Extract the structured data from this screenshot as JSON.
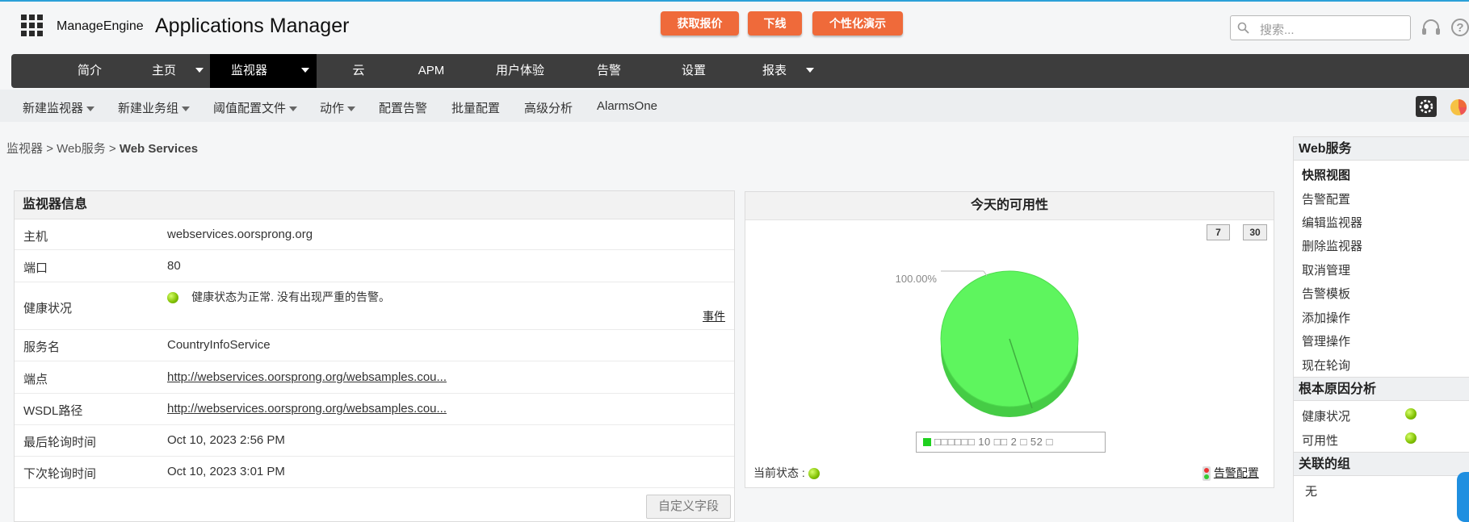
{
  "header": {
    "logo_brand": "ManageEngine",
    "logo_product": "Applications Manager",
    "buttons": {
      "quote": "获取报价",
      "download": "下线",
      "demo": "个性化演示"
    },
    "search_placeholder": "搜索...",
    "help_label": "?"
  },
  "nav": {
    "items": [
      {
        "label": "简介"
      },
      {
        "label": "主页"
      },
      {
        "label": "监视器"
      },
      {
        "label": "云"
      },
      {
        "label": "APM"
      },
      {
        "label": "用户体验"
      },
      {
        "label": "告警"
      },
      {
        "label": "设置"
      },
      {
        "label": "报表"
      }
    ],
    "active": "监视器"
  },
  "subnav": {
    "items": [
      {
        "label": "新建监视器"
      },
      {
        "label": "新建业务组"
      },
      {
        "label": "阈值配置文件"
      },
      {
        "label": "动作"
      },
      {
        "label": "配置告警"
      },
      {
        "label": "批量配置"
      },
      {
        "label": "高级分析"
      },
      {
        "label": "AlarmsOne"
      }
    ]
  },
  "breadcrumb": {
    "part1": "监视器",
    "sep": ">",
    "part2": "Web服务",
    "current": "Web Services"
  },
  "monitor_info": {
    "title": "监视器信息",
    "rows": [
      {
        "label": "主机",
        "value": "webservices.oorsprong.org"
      },
      {
        "label": "端口",
        "value": "80"
      },
      {
        "label": "健康状况",
        "value": "健康状态为正常. 没有出现严重的告警。",
        "link": "事件"
      },
      {
        "label": "服务名",
        "value": "CountryInfoService"
      },
      {
        "label": "端点",
        "value": "http://webservices.oorsprong.org/websamples.cou..."
      },
      {
        "label": "WSDL路径",
        "value": "http://webservices.oorsprong.org/websamples.cou..."
      },
      {
        "label": "最后轮询时间",
        "value": "Oct 10, 2023 2:56 PM"
      },
      {
        "label": "下次轮询时间",
        "value": "Oct 10, 2023 3:01 PM"
      }
    ],
    "custom_fields_button": "自定义字段"
  },
  "availability": {
    "title": "今天的可用性",
    "btn7": "7",
    "btn30": "30",
    "pie_label": "100.00%",
    "legend_text": "□□□□□□ 10 □□ 2 □ 52 □",
    "current_status_label": "当前状态 :",
    "alert_config_link": "告警配置",
    "colors": {
      "up": "#5ef55e",
      "legend_up": "#1fd01f"
    }
  },
  "chart_data": {
    "type": "pie",
    "categories": [
      "可用"
    ],
    "values": [
      100.0
    ],
    "title": "今天的可用性"
  },
  "sidebar": {
    "section1_title": "Web服务",
    "items": [
      {
        "label": "快照视图"
      },
      {
        "label": "告警配置"
      },
      {
        "label": "编辑监视器"
      },
      {
        "label": "删除监视器"
      },
      {
        "label": "取消管理"
      },
      {
        "label": "告警模板"
      },
      {
        "label": "添加操作"
      },
      {
        "label": "管理操作"
      },
      {
        "label": "现在轮询"
      }
    ],
    "section2_title": "根本原因分析",
    "rca": [
      {
        "label": "健康状况"
      },
      {
        "label": "可用性"
      }
    ],
    "section3_title": "关联的组",
    "groups_none": "无"
  }
}
